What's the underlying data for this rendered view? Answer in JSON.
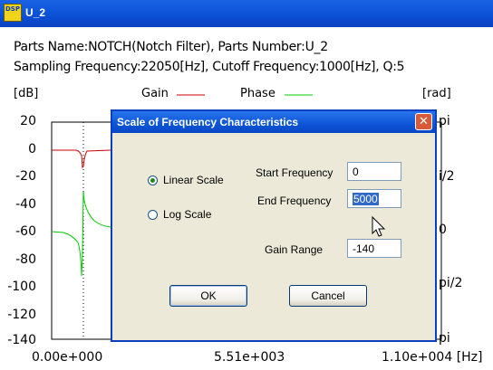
{
  "window": {
    "title": "U_2",
    "icon_text": "DSP"
  },
  "info": {
    "line1": "Parts Name:NOTCH(Notch Filter), Parts Number:U_2",
    "line2": "Sampling Frequency:22050[Hz], Cutoff Frequency:1000[Hz], Q:5"
  },
  "graph": {
    "left_unit": "[dB]",
    "right_unit": "[rad]",
    "legend_gain": "Gain",
    "legend_phase": "Phase",
    "gain_color": "#cc0000",
    "phase_color": "#00cc00",
    "yticks": [
      "20",
      "0",
      "-20",
      "-40",
      "-60",
      "-80",
      "-100",
      "-120",
      "-140"
    ],
    "right_ticks": [
      "pi",
      "i/2",
      "0",
      "pi/2",
      "pi"
    ],
    "xticks": [
      "0.00e+000",
      "5.51e+003",
      "1.10e+004 [Hz]"
    ]
  },
  "dialog": {
    "title": "Scale of Frequency Characteristics",
    "linear_label": "Linear Scale",
    "log_label": "Log Scale",
    "selected_scale": "Linear Scale",
    "start_label": "Start Frequency",
    "start_value": "0",
    "end_label": "End Frequency",
    "end_value": "5000",
    "gain_range_label": "Gain Range",
    "gain_range_value": "-140",
    "ok_label": "OK",
    "cancel_label": "Cancel",
    "close_glyph": "✕"
  }
}
